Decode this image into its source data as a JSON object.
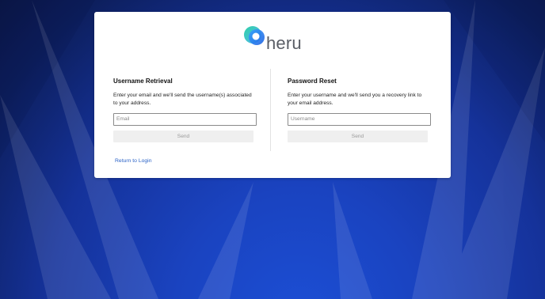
{
  "brand": {
    "name": "heru",
    "logo_icon": "heru-logo-icon"
  },
  "username_retrieval": {
    "title": "Username Retrieval",
    "description": "Enter your email and we'll send the username(s) associated to your address.",
    "input_value": "",
    "input_placeholder": "Email",
    "button_label": "Send"
  },
  "password_reset": {
    "title": "Password Reset",
    "description": "Enter your username and we'll send you a recovery link to your email address.",
    "input_value": "",
    "input_placeholder": "Username",
    "button_label": "Send"
  },
  "footer": {
    "return_link": "Return to Login"
  },
  "colors": {
    "background": "#1a43c0",
    "card": "#ffffff",
    "link": "#2b63c7",
    "button_bg": "#efefef",
    "button_text": "#9a9a9a"
  }
}
